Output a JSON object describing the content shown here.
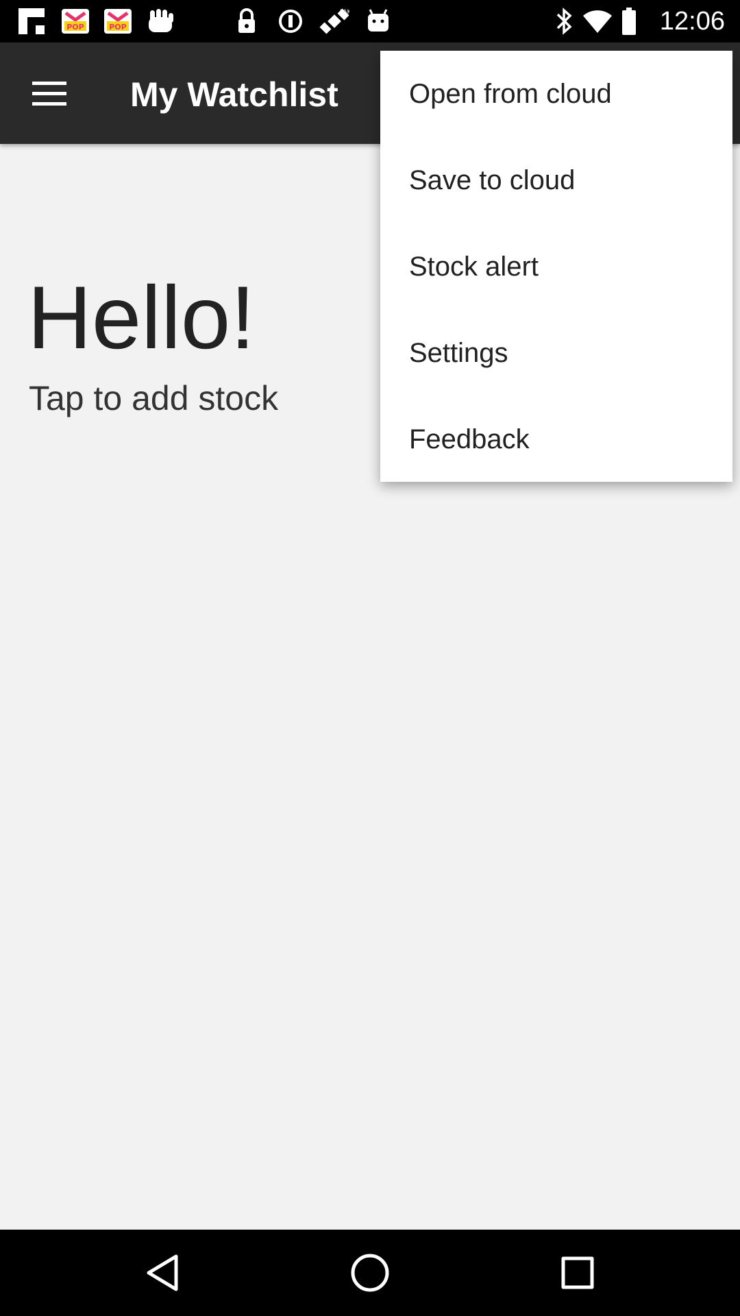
{
  "status_bar": {
    "time": "12:06",
    "icons": [
      "flipboard-icon",
      "pop-app-icon",
      "pop-app-icon",
      "hand-icon",
      "lock-icon",
      "sync-icon",
      "satellite-icon",
      "android-icon"
    ]
  },
  "app_bar": {
    "title": "My Watchlist"
  },
  "main": {
    "greeting": "Hello!",
    "prompt": "Tap to add stock"
  },
  "overflow_menu": {
    "items": [
      {
        "label": "Open from cloud"
      },
      {
        "label": "Save to cloud"
      },
      {
        "label": "Stock alert"
      },
      {
        "label": "Settings"
      },
      {
        "label": "Feedback"
      }
    ]
  },
  "nav_bar": {
    "icons": [
      "back-icon",
      "home-icon",
      "recents-icon"
    ]
  },
  "colors": {
    "status_bar": "#000000",
    "app_bar": "#2a2a2a",
    "background": "#f2f2f2",
    "menu": "#ffffff",
    "accent_pink": "#e5336b",
    "accent_yellow": "#f5d311"
  }
}
